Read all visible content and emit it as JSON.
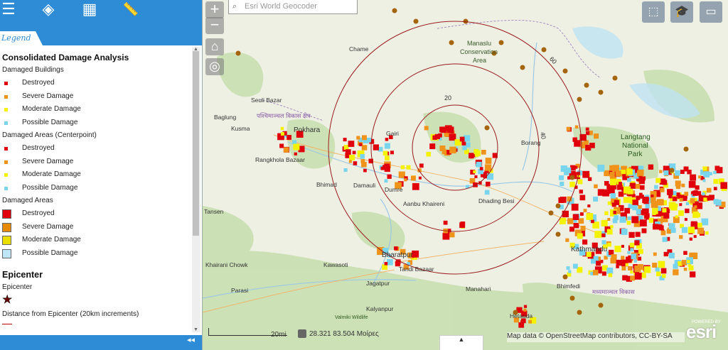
{
  "toolbar": {
    "buttons": [
      {
        "icon": "list-icon",
        "glyph": "☰"
      },
      {
        "icon": "layers-icon",
        "glyph": "◈"
      },
      {
        "icon": "basemap-grid-icon",
        "glyph": "▦"
      },
      {
        "icon": "measure-ruler-icon",
        "glyph": "📏"
      }
    ]
  },
  "tabs": {
    "legend": "Legend"
  },
  "legend": {
    "title": "Consolidated Damage Analysis",
    "groups": [
      {
        "name": "Damaged Buildings",
        "items": [
          {
            "label": "Destroyed",
            "color": "#e0000b"
          },
          {
            "label": "Severe Damage",
            "color": "#f0931a"
          },
          {
            "label": "Moderate Damage",
            "color": "#f5f200"
          },
          {
            "label": "Possible Damage",
            "color": "#79d5ed"
          }
        ]
      },
      {
        "name": "Damaged Areas (Centerpoint)",
        "items": [
          {
            "label": "Destroyed",
            "color": "#e0000b"
          },
          {
            "label": "Severe Damage",
            "color": "#f0931a"
          },
          {
            "label": "Moderate Damage",
            "color": "#f5f200"
          },
          {
            "label": "Possible Damage",
            "color": "#79d5ed"
          }
        ]
      },
      {
        "name": "Damaged Areas",
        "items": [
          {
            "label": "Destroyed",
            "color": "#e0000b"
          },
          {
            "label": "Severe Damage",
            "color": "#e88a00"
          },
          {
            "label": "Moderate Damage",
            "color": "#e8df00"
          },
          {
            "label": "Possible Damage",
            "color": "#bfe6f7"
          }
        ]
      }
    ],
    "epicenter_title": "Epicenter",
    "epicenter_label": "Epicenter",
    "epicenter_glyph": "★",
    "distance_label": "Distance from Epicenter (20km increments)"
  },
  "panel_footer": {
    "collapse_glyph": "◂◂"
  },
  "map": {
    "zoom_in": "+",
    "zoom_out": "−",
    "home_glyph": "⌂",
    "locate_glyph": "◎",
    "search_placeholder": "Esri World Geocoder",
    "tools": [
      {
        "icon": "select-tool-icon",
        "glyph": "⬚"
      },
      {
        "icon": "education-cap-icon",
        "glyph": "🎓"
      },
      {
        "icon": "folder-icon",
        "glyph": "▭"
      }
    ],
    "ring_labels": [
      "20",
      "40",
      "60"
    ],
    "places": [
      {
        "name": "Chame"
      },
      {
        "name": "Manaslu"
      },
      {
        "name": "Conservation"
      },
      {
        "name": "Area"
      },
      {
        "name": "Seuli Bazar"
      },
      {
        "name": "Baglung"
      },
      {
        "name": "Kusma"
      },
      {
        "name": "Pokhara"
      },
      {
        "name": "Rangkhola Bazaar"
      },
      {
        "name": "Tansen"
      },
      {
        "name": "Bhimad"
      },
      {
        "name": "Damauli"
      },
      {
        "name": "Dumre"
      },
      {
        "name": "Gairi"
      },
      {
        "name": "Aanbu Khaireni"
      },
      {
        "name": "Dhading Besi"
      },
      {
        "name": "Borang"
      },
      {
        "name": "Langtang"
      },
      {
        "name": "National"
      },
      {
        "name": "Park"
      },
      {
        "name": "Bharatpur"
      },
      {
        "name": "Tandi Bazaar"
      },
      {
        "name": "Kawasoti"
      },
      {
        "name": "Khairani Chowk"
      },
      {
        "name": "Parasi"
      },
      {
        "name": "Jagatpur"
      },
      {
        "name": "Kalyanpur"
      },
      {
        "name": "Manahari"
      },
      {
        "name": "Bhimfedi"
      },
      {
        "name": "Hetauda"
      },
      {
        "name": "Kathmandu"
      },
      {
        "name": "Valmiki Wildlife"
      },
      {
        "name": "पश्चिमाञ्चल विकास क्षेत्र"
      },
      {
        "name": "मध्यमाञ्चल विकास"
      }
    ],
    "scale_label": "20mi",
    "coordinates": "28.321  83.504 Μοίρες",
    "attribution": "Map data © OpenStreetMap contributors, CC-BY-SA",
    "esri_logo": "esri",
    "powered_by": "POWERED BY",
    "expander_glyph": "▲"
  }
}
